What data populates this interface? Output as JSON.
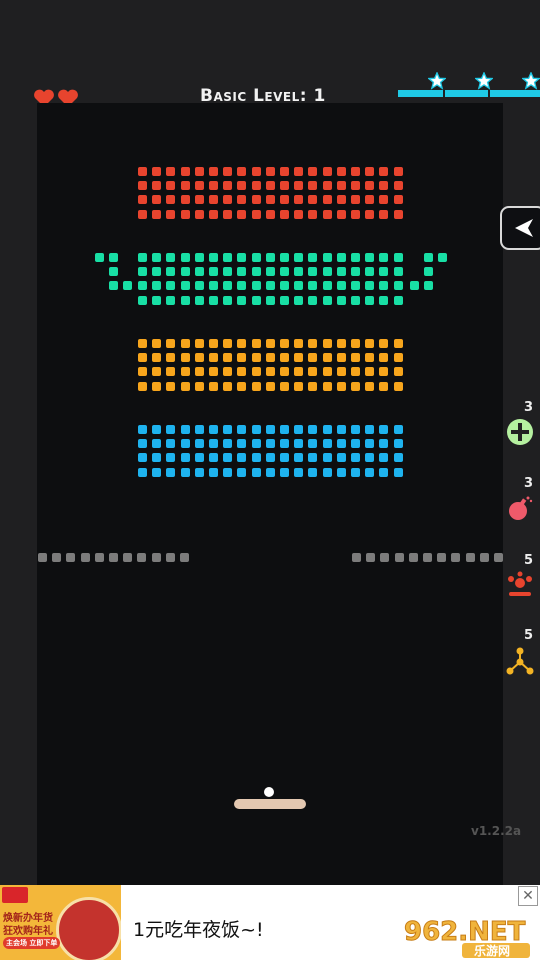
{
  "header": {
    "lives": 2,
    "level_title": "Basic Level: 1",
    "stars": 3
  },
  "colors": {
    "heart": "#e8442e",
    "row_red": "#e8442e",
    "row_green": "#18dfa5",
    "row_orange": "#f7a51c",
    "row_blue": "#1eb3ef",
    "row_gray": "#7c7c7c",
    "progress": "#1fc9e6"
  },
  "back_button": {
    "icon": "back-arrow-icon"
  },
  "powerups": [
    {
      "name": "extra-ball",
      "icon": "plus-circle-icon",
      "count": "3"
    },
    {
      "name": "bomb",
      "icon": "bomb-icon",
      "count": "3"
    },
    {
      "name": "split",
      "icon": "fountain-icon",
      "count": "5"
    },
    {
      "name": "triple",
      "icon": "molecule-icon",
      "count": "5"
    }
  ],
  "version": "v1.2.2a",
  "ad": {
    "image_lines": [
      "焕新办年货",
      "狂欢购年礼",
      "主会场  立即下单"
    ],
    "text": "1元吃年夜饭~!",
    "logo_text": "962.NET",
    "logo_sub": "乐游网",
    "close_label": "✕"
  }
}
